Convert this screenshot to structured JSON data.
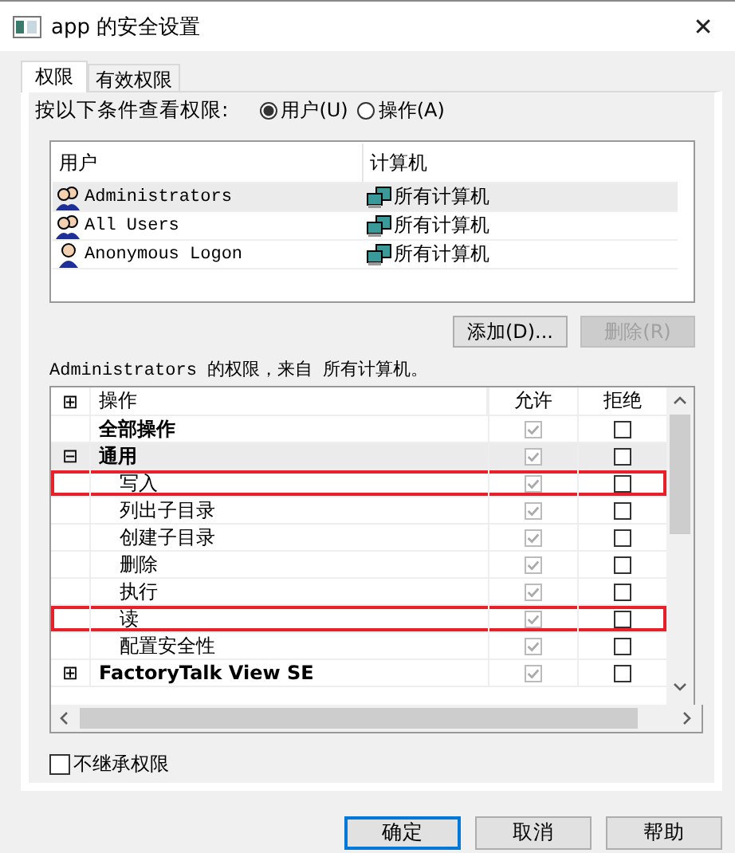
{
  "window": {
    "title": "app 的安全设置",
    "close": "✕"
  },
  "tabs": [
    {
      "label": "权限",
      "selected": true
    },
    {
      "label": "有效权限",
      "selected": false
    }
  ],
  "view_by": {
    "label": "按以下条件查看权限:",
    "options": [
      {
        "label": "用户(U)",
        "selected": true
      },
      {
        "label": "操作(A)",
        "selected": false
      }
    ]
  },
  "users_table": {
    "columns": [
      "用户",
      "计算机"
    ],
    "rows": [
      {
        "kind": "group",
        "user": "Administrators",
        "computer": "所有计算机",
        "selected": true
      },
      {
        "kind": "group",
        "user": "All Users",
        "computer": "所有计算机",
        "selected": false
      },
      {
        "kind": "user",
        "user": "Anonymous Logon",
        "computer": "所有计算机",
        "selected": false
      }
    ]
  },
  "user_buttons": [
    {
      "label": "添加(D)...",
      "disabled": false
    },
    {
      "label": "删除(R)",
      "disabled": true
    }
  ],
  "permissions_caption": "Administrators 的权限，来自 所有计算机。",
  "permissions": {
    "columns": [
      "操作",
      "允许",
      "拒绝"
    ],
    "header_expander": "⊞",
    "rows": [
      {
        "label": "全部操作",
        "bold": true,
        "selected": false,
        "highlighted": false,
        "allow": true,
        "deny": false
      },
      {
        "label": "通用",
        "bold": true,
        "expander": "⊟",
        "selected": true,
        "highlighted": false,
        "allow": true,
        "deny": false,
        "children": [
          {
            "label": "写入",
            "bold": false,
            "selected": false,
            "highlighted": true,
            "allow": true,
            "deny": false
          },
          {
            "label": "列出子目录",
            "bold": false,
            "selected": false,
            "highlighted": false,
            "allow": true,
            "deny": false
          },
          {
            "label": "创建子目录",
            "bold": false,
            "selected": false,
            "highlighted": false,
            "allow": true,
            "deny": false
          },
          {
            "label": "删除",
            "bold": false,
            "selected": false,
            "highlighted": false,
            "allow": true,
            "deny": false
          },
          {
            "label": "执行",
            "bold": false,
            "selected": false,
            "highlighted": false,
            "allow": true,
            "deny": false
          },
          {
            "label": "读",
            "bold": false,
            "selected": false,
            "highlighted": true,
            "allow": true,
            "deny": false
          },
          {
            "label": "配置安全性",
            "bold": false,
            "selected": false,
            "highlighted": false,
            "allow": true,
            "deny": false
          }
        ]
      },
      {
        "label": "FactoryTalk View SE",
        "bold": true,
        "expander": "⊞",
        "selected": false,
        "highlighted": false,
        "allow": true,
        "deny": false
      }
    ]
  },
  "no_inherit": {
    "label": "不继承权限",
    "checked": false
  },
  "buttons": [
    {
      "label": "确定",
      "default": true
    },
    {
      "label": "取消",
      "default": false
    },
    {
      "label": "帮助",
      "default": false
    }
  ]
}
